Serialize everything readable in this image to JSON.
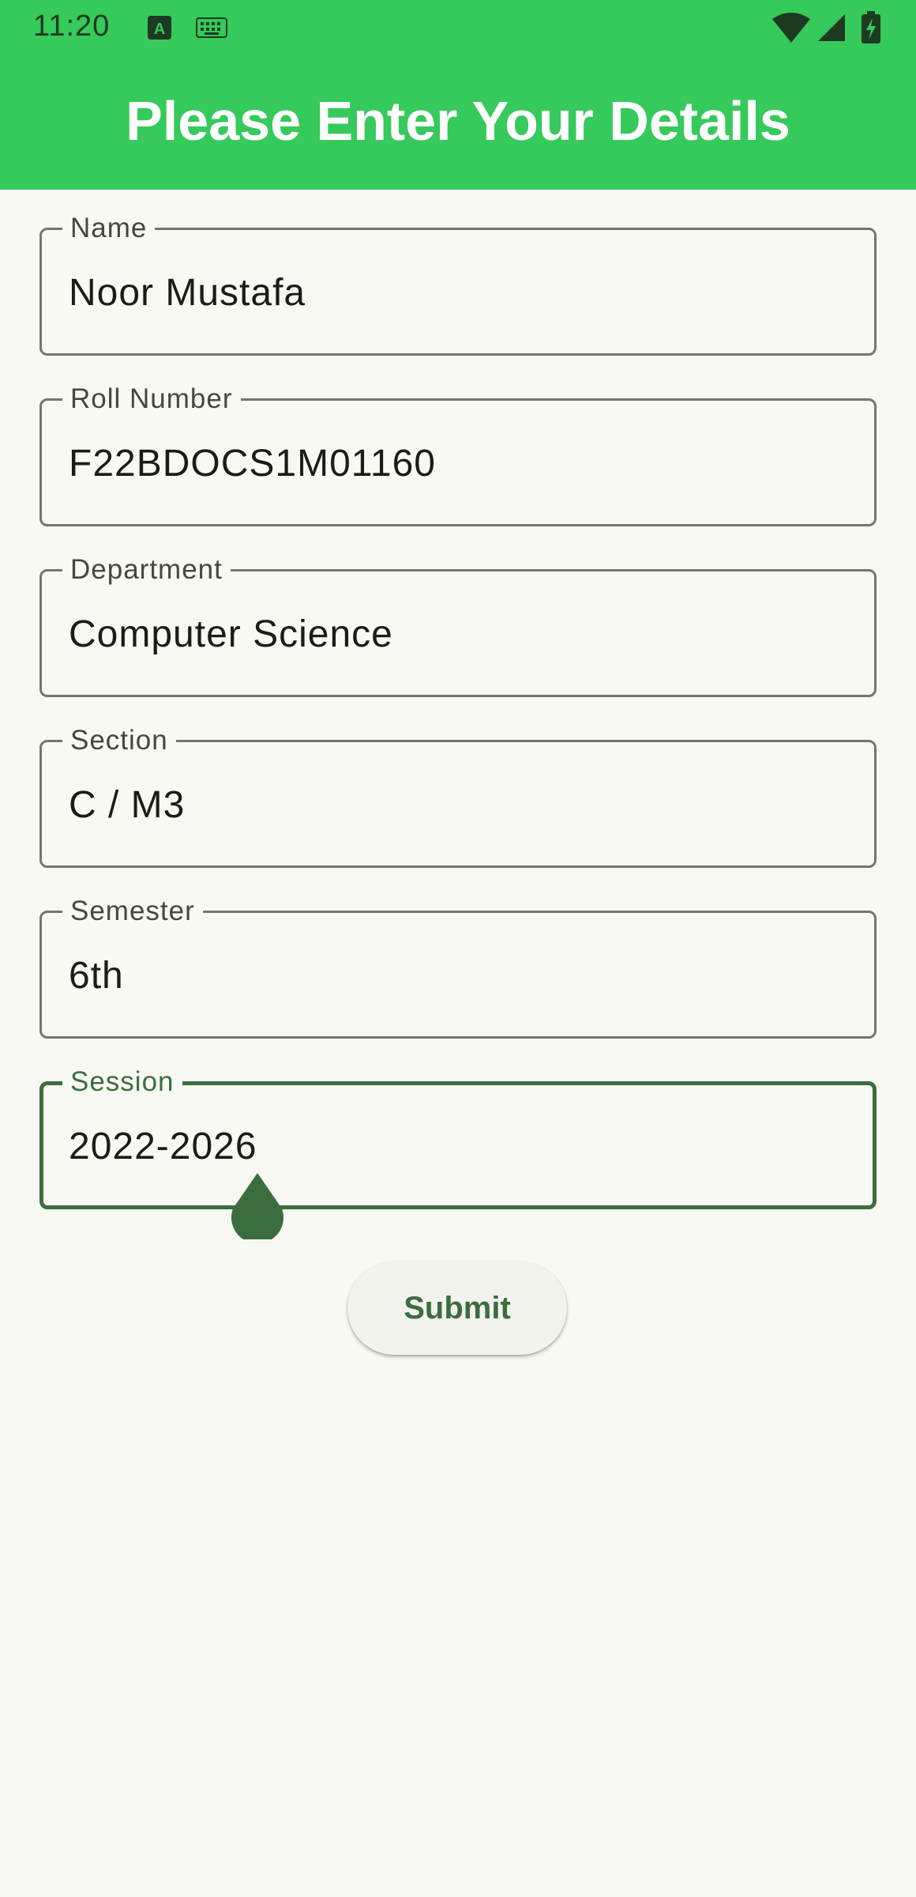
{
  "status_bar": {
    "time": "11:20",
    "left_icons": [
      "font-badge-icon",
      "keyboard-icon"
    ],
    "right_icons": [
      "wifi-icon",
      "cellular-signal-icon",
      "battery-charging-icon"
    ]
  },
  "app_bar": {
    "title": "Please Enter Your Details",
    "background_color": "#36c95b"
  },
  "form": {
    "fields": [
      {
        "label": "Name",
        "value": "Noor Mustafa"
      },
      {
        "label": "Roll Number",
        "value": "F22BDOCS1M01160"
      },
      {
        "label": "Department",
        "value": "Computer Science"
      },
      {
        "label": "Section",
        "value": "C / M3"
      },
      {
        "label": "Semester",
        "value": "6th"
      },
      {
        "label": "Session",
        "value": "2022-2026",
        "focused": true
      }
    ],
    "submit_label": "Submit",
    "accent_color": "#3c6d3f"
  }
}
